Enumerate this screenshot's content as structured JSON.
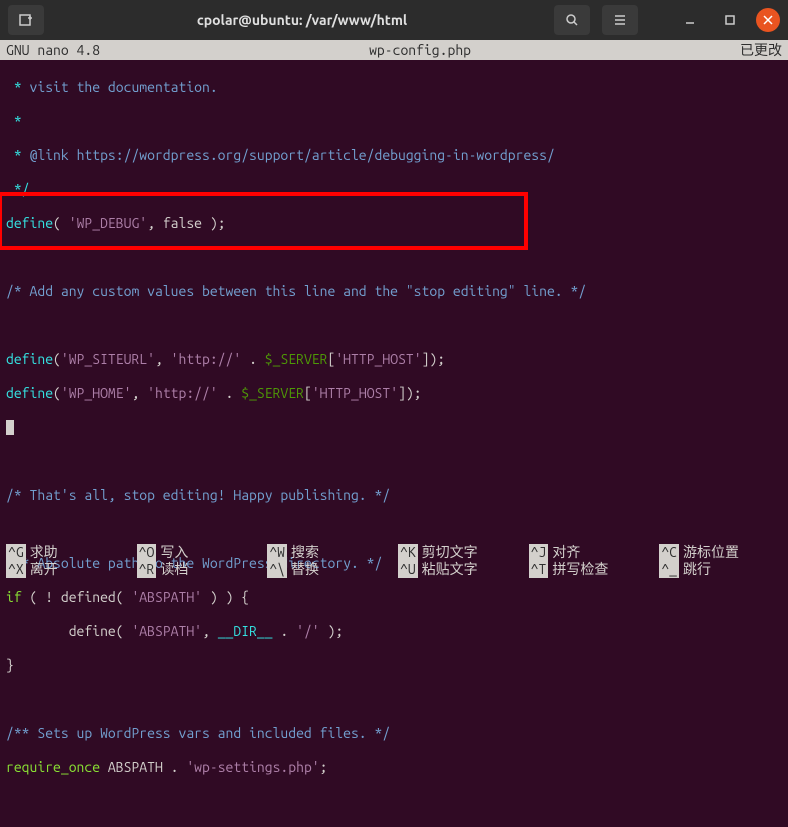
{
  "titlebar": {
    "title": "cpolar@ubuntu: /var/www/html"
  },
  "statusbar": {
    "app": "GNU nano 4.8",
    "filename": "wp-config.php",
    "modified": "已更改"
  },
  "code": {
    "l1_a": " *",
    "l1_b": " visit the documentation.",
    "l2": " *",
    "l3_a": " *",
    "l3_b": " @link https://wordpress.org/support/article/debugging-in-wordpress/",
    "l4": " */",
    "l5_func": "define",
    "l5_p1": "( ",
    "l5_s1": "'WP_DEBUG'",
    "l5_p2": ", false );",
    "l7": "/* Add any custom values between this line and the \"stop editing\" line. */",
    "l9_func": "define",
    "l9_p1": "(",
    "l9_s1": "'WP_SITEURL'",
    "l9_p2": ", ",
    "l9_s2": "'http://'",
    "l9_p3": " . ",
    "l9_v": "$_SERVER",
    "l9_p4": "[",
    "l9_s3": "'HTTP_HOST'",
    "l9_p5": "]);",
    "l10_func": "define",
    "l10_p1": "(",
    "l10_s1": "'WP_HOME'",
    "l10_p2": ", ",
    "l10_s2": "'http://'",
    "l10_p3": " . ",
    "l10_v": "$_SERVER",
    "l10_p4": "[",
    "l10_s3": "'HTTP_HOST'",
    "l10_p5": "]);",
    "l13": "/* That's all, stop editing! Happy publishing. */",
    "l15": "/** Absolute path to the WordPress directory. */",
    "l16_kw": "if",
    "l16_p1": " ( ! defined( ",
    "l16_s1": "'ABSPATH'",
    "l16_p2": " ) ) {",
    "l17_p1": "        define( ",
    "l17_s1": "'ABSPATH'",
    "l17_p2": ", ",
    "l17_kw": "__DIR__",
    "l17_p3": " . ",
    "l17_s2": "'/'",
    "l17_p4": " );",
    "l18": "}",
    "l20": "/** Sets up WordPress vars and included files. */",
    "l21_kw": "require_once",
    "l21_p1": " ABSPATH . ",
    "l21_s1": "'wp-settings.php'",
    "l21_p2": ";"
  },
  "shortcuts": {
    "r1c1k": "^G",
    "r1c1l": "求助",
    "r1c2k": "^O",
    "r1c2l": "写入",
    "r1c3k": "^W",
    "r1c3l": "搜索",
    "r1c4k": "^K",
    "r1c4l": "剪切文字",
    "r1c5k": "^J",
    "r1c5l": "对齐",
    "r1c6k": "^C",
    "r1c6l": "游标位置",
    "r2c1k": "^X",
    "r2c1l": "离开",
    "r2c2k": "^R",
    "r2c2l": "读档",
    "r2c3k": "^\\",
    "r2c3l": "替换",
    "r2c4k": "^U",
    "r2c4l": "粘贴文字",
    "r2c5k": "^T",
    "r2c5l": "拼写检查",
    "r2c6k": "^_",
    "r2c6l": "跳行"
  }
}
